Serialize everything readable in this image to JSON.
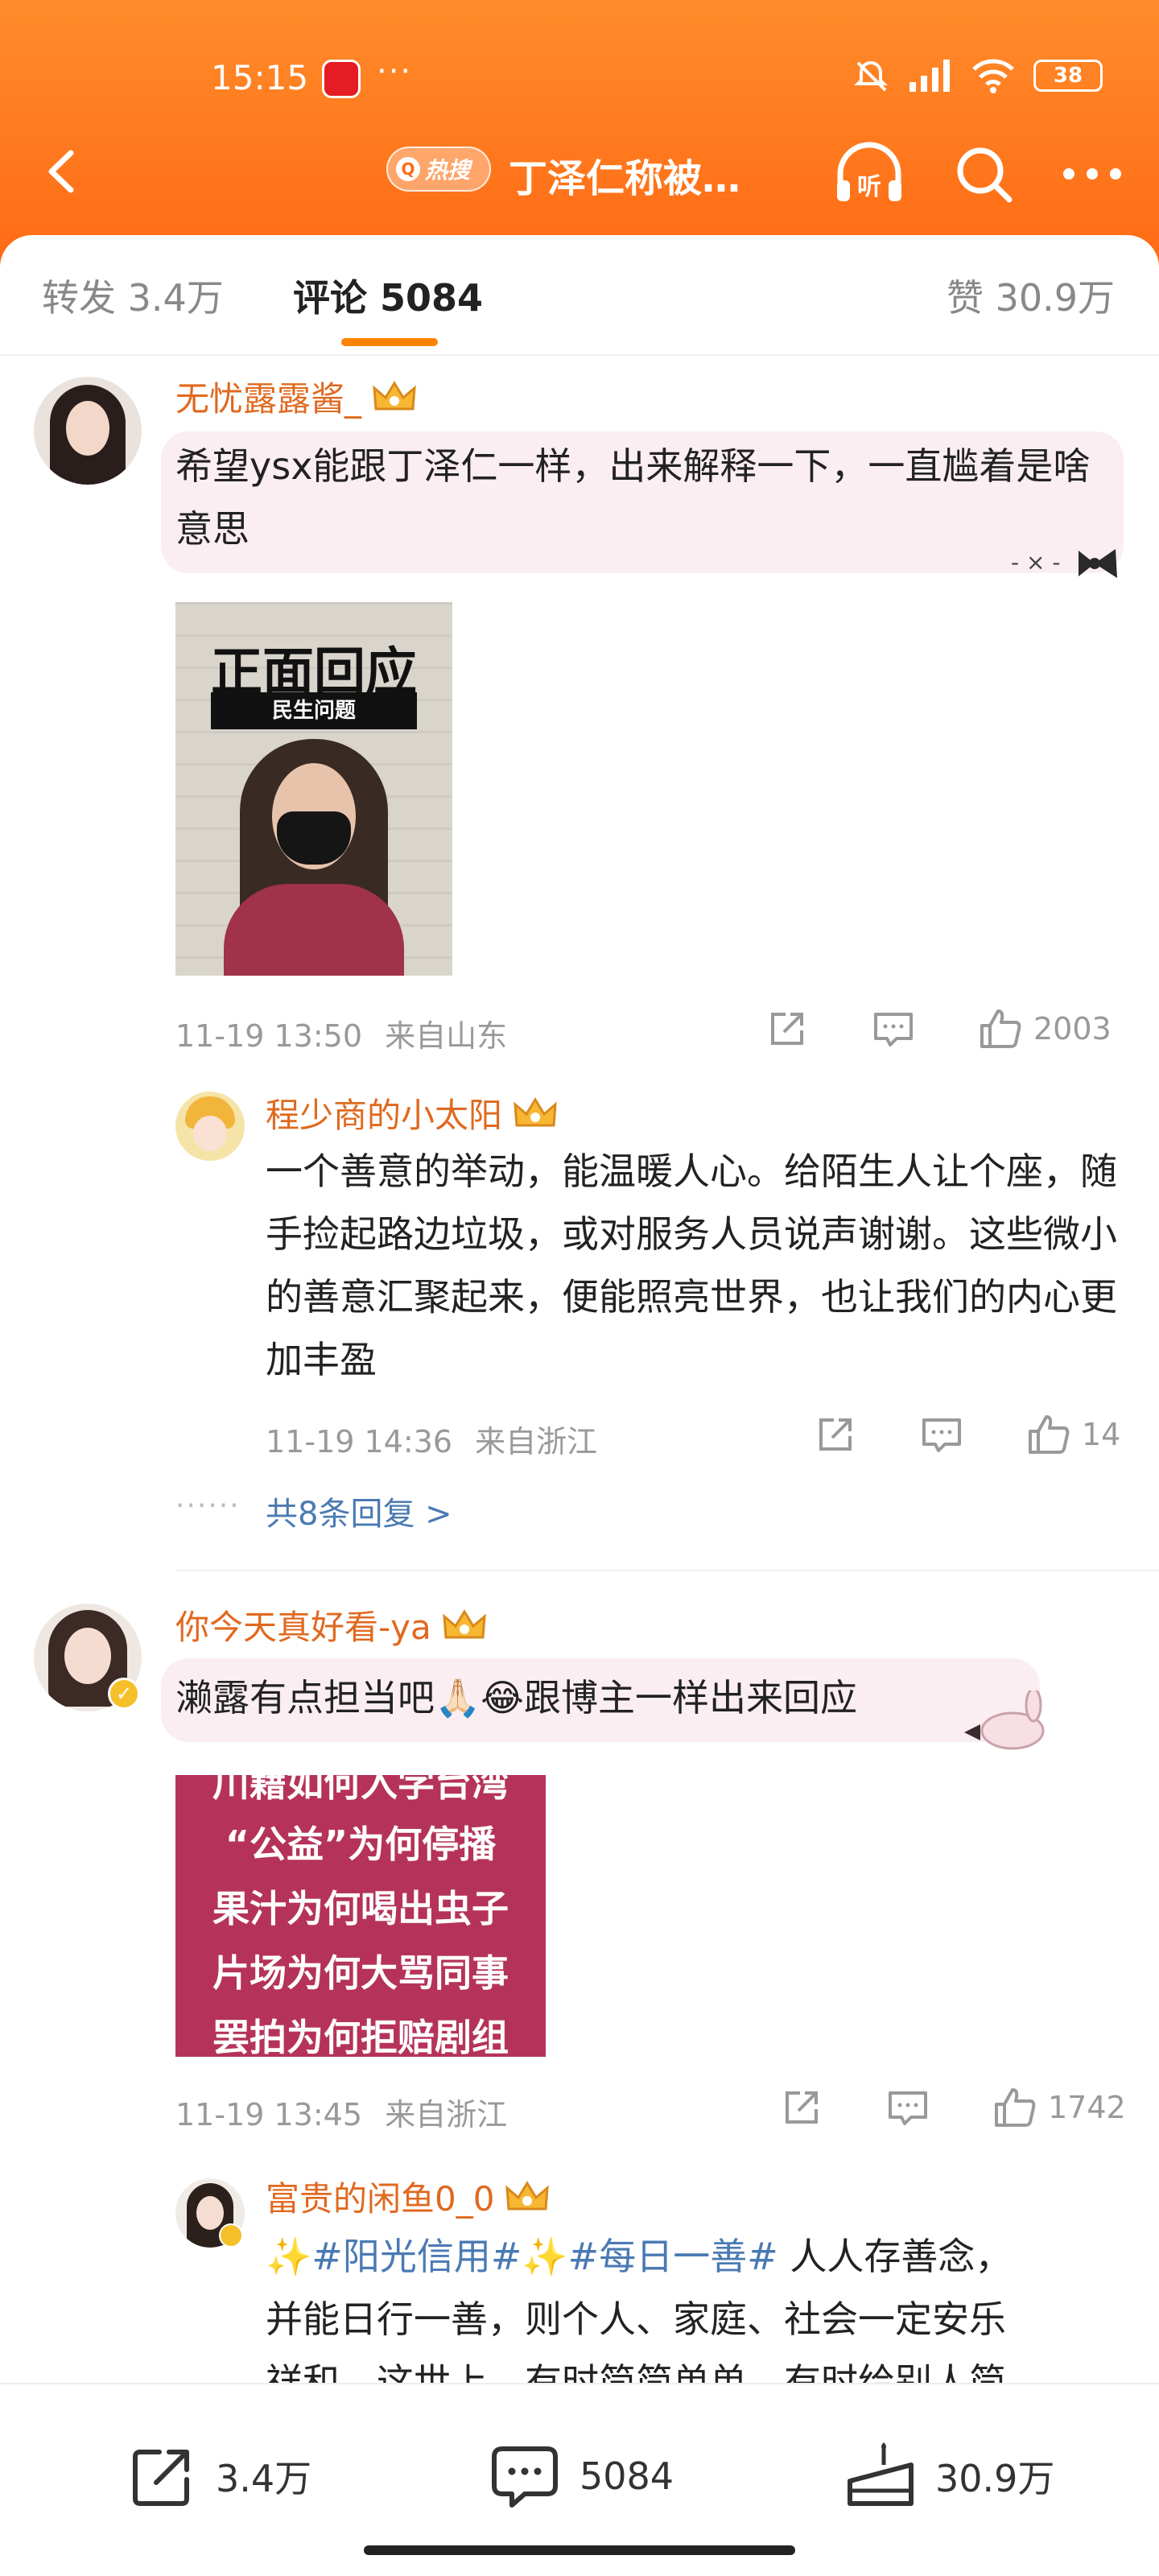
{
  "status": {
    "time": "15:15",
    "more": "···",
    "battery": "38"
  },
  "nav": {
    "hot_label": "热搜",
    "title": "丁泽仁称被…"
  },
  "tabs": {
    "repost": "转发 3.4万",
    "comments": "评论 5084",
    "likes": "赞 30.9万"
  },
  "comments": [
    {
      "username": "无忧露露酱_",
      "text": "希望ysx能跟丁泽仁一样，出来解释一下，一直尴着是啥意思",
      "image_title": "正面回应",
      "image_subtitle": "民生问题",
      "time": "11-19 13:50",
      "location": "来自山东",
      "likes": "2003",
      "reply": {
        "username": "程少商的小太阳",
        "text": "一个善意的举动，能温暖人心。给陌生人让个座，随手捡起路边垃圾，或对服务人员说声谢谢。这些微小的善意汇聚起来，便能照亮世界，也让我们的内心更加丰盈",
        "time": "11-19 14:36",
        "location": "来自浙江",
        "likes": "14"
      },
      "more_replies": "共8条回复 >"
    },
    {
      "username": "你今天真好看-ya",
      "text": "濑露有点担当吧🙏🏻😂跟博主一样出来回应",
      "image_lines": [
        "川籍如何入学台湾",
        "“公益”为何停播",
        "果汁为何喝出虫子",
        "片场为何大骂同事",
        "罢拍为何拒赔剧组"
      ],
      "time": "11-19 13:45",
      "location": "来自浙江",
      "likes": "1742",
      "reply": {
        "username": "富贵的闲鱼0_0",
        "tag1": "✨#阳光信用#",
        "tag2": "✨#每日一善#",
        "text_a": " 人人存善念，",
        "text_b": "并能日行一善，则个人、家庭、社会一定安乐",
        "text_c": "祥和，这世上，有时简简单单，有时给别人简"
      }
    }
  ],
  "bottom": {
    "repost": "3.4万",
    "comments": "5084",
    "likes": "30.9万"
  },
  "colors": {
    "accent": "#ff8200",
    "username": "#e0691f",
    "link": "#4a7ab3"
  }
}
